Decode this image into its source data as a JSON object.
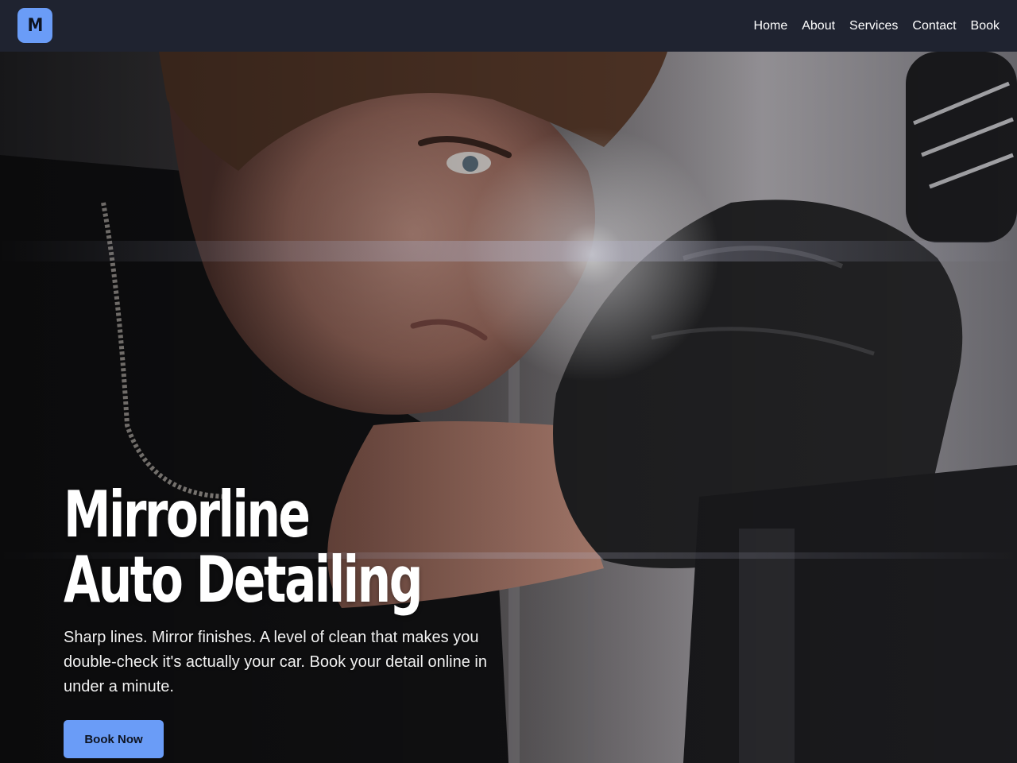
{
  "brand": {
    "logo_letter": "M",
    "accent_color": "#6a9cf7",
    "nav_bg": "#1f2330"
  },
  "nav": {
    "items": [
      {
        "label": "Home"
      },
      {
        "label": "About"
      },
      {
        "label": "Services"
      },
      {
        "label": "Contact"
      },
      {
        "label": "Book"
      }
    ]
  },
  "hero": {
    "title_line1": "Mirrorline",
    "title_line2": "Auto Detailing",
    "subtitle": "Sharp lines. Mirror finishes. A level of clean that makes you double-check it's actually your car. Book your detail online in under a minute.",
    "cta_label": "Book Now",
    "image": "detailer-hero-photo"
  }
}
